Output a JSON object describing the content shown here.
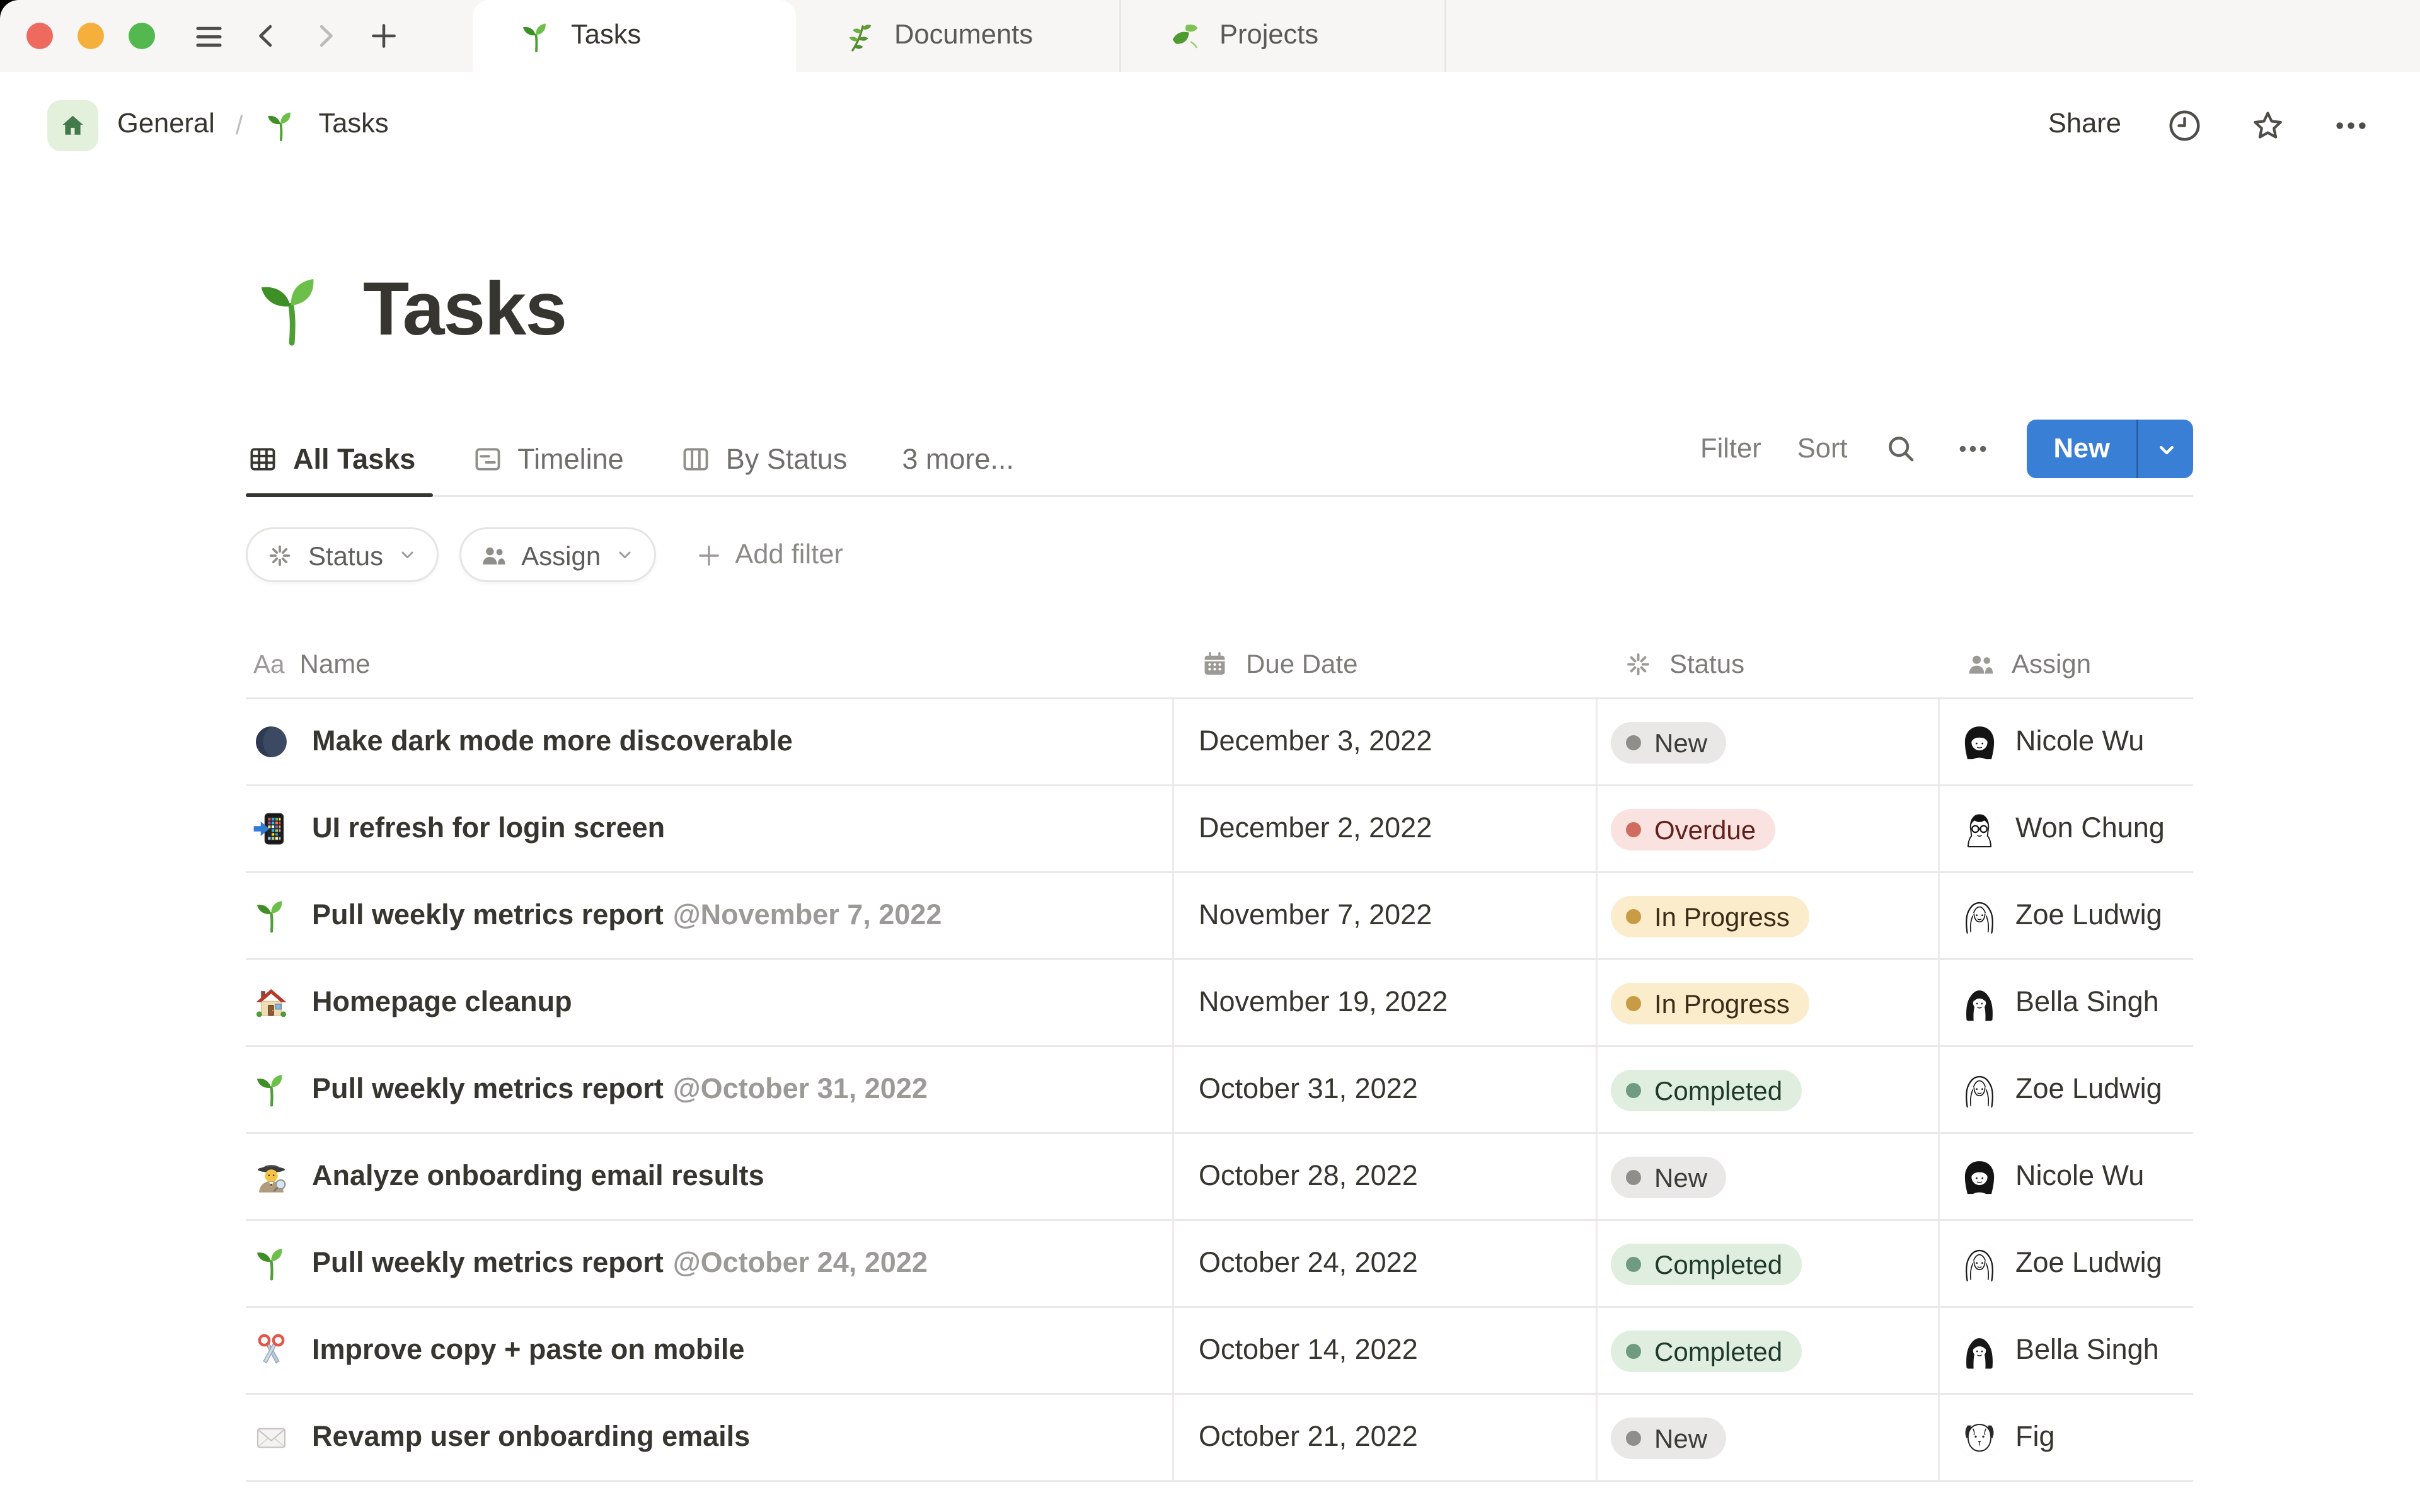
{
  "window": {
    "tabs": [
      {
        "label": "Tasks",
        "icon": "seedling",
        "active": true
      },
      {
        "label": "Documents",
        "icon": "herb",
        "active": false
      },
      {
        "label": "Projects",
        "icon": "leaves",
        "active": false
      }
    ]
  },
  "breadcrumb": {
    "root": "General",
    "separator": "/",
    "current": "Tasks",
    "current_icon": "seedling",
    "share_label": "Share"
  },
  "page": {
    "title": "Tasks",
    "title_icon": "seedling"
  },
  "views": {
    "tabs": [
      {
        "label": "All Tasks",
        "icon": "table-view",
        "active": true
      },
      {
        "label": "Timeline",
        "icon": "timeline-view",
        "active": false
      },
      {
        "label": "By Status",
        "icon": "board-view",
        "active": false
      },
      {
        "label": "3 more...",
        "icon": null,
        "active": false
      }
    ],
    "filter_label": "Filter",
    "sort_label": "Sort",
    "new_label": "New"
  },
  "filters": {
    "chips": [
      {
        "label": "Status",
        "icon": "status-burst"
      },
      {
        "label": "Assign",
        "icon": "people"
      }
    ],
    "add_label": "Add filter"
  },
  "table": {
    "aa_glyph": "Aa",
    "columns": [
      {
        "label": "Name",
        "icon": "aa"
      },
      {
        "label": "Due Date",
        "icon": "calendar"
      },
      {
        "label": "Status",
        "icon": "status-burst"
      },
      {
        "label": "Assign",
        "icon": "people"
      }
    ],
    "rows": [
      {
        "icon": "new-moon",
        "name": "Make dark mode more discoverable",
        "mention": "",
        "due": "December 3, 2022",
        "status": {
          "label": "New",
          "color": "gray"
        },
        "assignee": {
          "name": "Nicole Wu",
          "avatar": "nicole"
        }
      },
      {
        "icon": "mobile-phone-arrow",
        "name": "UI refresh for login screen",
        "mention": "",
        "due": "December 2, 2022",
        "status": {
          "label": "Overdue",
          "color": "red"
        },
        "assignee": {
          "name": "Won Chung",
          "avatar": "won"
        }
      },
      {
        "icon": "seedling",
        "name": "Pull weekly metrics report",
        "mention": "@November 7, 2022",
        "due": "November 7, 2022",
        "status": {
          "label": "In Progress",
          "color": "yellow"
        },
        "assignee": {
          "name": "Zoe Ludwig",
          "avatar": "zoe"
        }
      },
      {
        "icon": "house",
        "name": "Homepage cleanup",
        "mention": "",
        "due": "November 19, 2022",
        "status": {
          "label": "In Progress",
          "color": "yellow"
        },
        "assignee": {
          "name": "Bella Singh",
          "avatar": "bella"
        }
      },
      {
        "icon": "seedling",
        "name": "Pull weekly metrics report",
        "mention": "@October 31, 2022",
        "due": "October 31, 2022",
        "status": {
          "label": "Completed",
          "color": "green"
        },
        "assignee": {
          "name": "Zoe Ludwig",
          "avatar": "zoe"
        }
      },
      {
        "icon": "detective",
        "name": "Analyze onboarding email results",
        "mention": "",
        "due": "October 28, 2022",
        "status": {
          "label": "New",
          "color": "gray"
        },
        "assignee": {
          "name": "Nicole Wu",
          "avatar": "nicole"
        }
      },
      {
        "icon": "seedling",
        "name": "Pull weekly metrics report",
        "mention": "@October 24, 2022",
        "due": "October 24, 2022",
        "status": {
          "label": "Completed",
          "color": "green"
        },
        "assignee": {
          "name": "Zoe Ludwig",
          "avatar": "zoe"
        }
      },
      {
        "icon": "scissors",
        "name": "Improve copy + paste on mobile",
        "mention": "",
        "due": "October 14, 2022",
        "status": {
          "label": "Completed",
          "color": "green"
        },
        "assignee": {
          "name": "Bella Singh",
          "avatar": "bella"
        }
      },
      {
        "icon": "envelope",
        "name": "Revamp user onboarding emails",
        "mention": "",
        "due": "October 21, 2022",
        "status": {
          "label": "New",
          "color": "gray"
        },
        "assignee": {
          "name": "Fig",
          "avatar": "fig"
        }
      }
    ]
  },
  "colors": {
    "accent_blue": "#3a7fd6",
    "status_gray_bg": "#e9e8e6",
    "status_red_bg": "#fae2e0",
    "status_yellow_bg": "#fbedcb",
    "status_green_bg": "#dfeedf",
    "traffic_red": "#ee6a5f",
    "traffic_yellow": "#f5b03b",
    "traffic_green": "#53b94f"
  }
}
